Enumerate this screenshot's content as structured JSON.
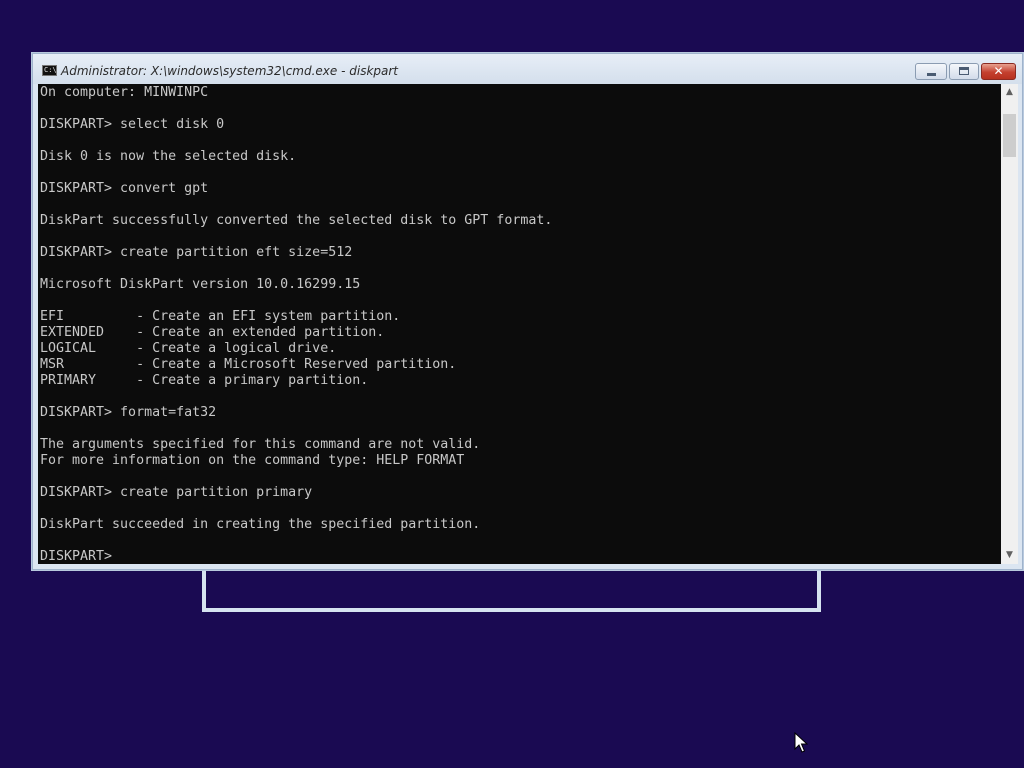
{
  "desktop": {
    "background_color": "#1a0a52"
  },
  "window": {
    "title": "Administrator: X:\\windows\\system32\\cmd.exe - diskpart",
    "icon": "cmd-icon",
    "icon_text": "C:\\",
    "controls": {
      "minimize_icon": "minimize-icon",
      "maximize_icon": "restore-icon",
      "close_icon": "close-icon",
      "close_label": "✕"
    }
  },
  "console": {
    "background_color": "#0c0c0c",
    "text_color": "#c8c8c8",
    "lines": [
      "On computer: MINWINPC",
      "",
      "DISKPART> select disk 0",
      "",
      "Disk 0 is now the selected disk.",
      "",
      "DISKPART> convert gpt",
      "",
      "DiskPart successfully converted the selected disk to GPT format.",
      "",
      "DISKPART> create partition eft size=512",
      "",
      "Microsoft DiskPart version 10.0.16299.15",
      "",
      "EFI         - Create an EFI system partition.",
      "EXTENDED    - Create an extended partition.",
      "LOGICAL     - Create a logical drive.",
      "MSR         - Create a Microsoft Reserved partition.",
      "PRIMARY     - Create a primary partition.",
      "",
      "DISKPART> format=fat32",
      "",
      "The arguments specified for this command are not valid.",
      "For more information on the command type: HELP FORMAT",
      "",
      "DISKPART> create partition primary",
      "",
      "DiskPart succeeded in creating the specified partition.",
      "",
      "DISKPART> "
    ]
  },
  "scrollbar": {
    "up_arrow": "▲",
    "down_arrow": "▼",
    "up_icon": "chevron-up-icon",
    "down_icon": "chevron-down-icon"
  },
  "cursor": {
    "icon": "mouse-pointer-icon"
  }
}
